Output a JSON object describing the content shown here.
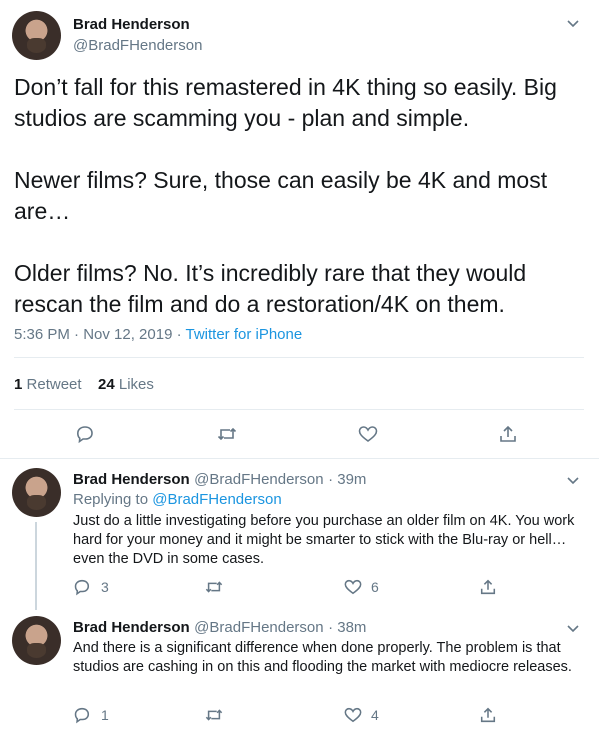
{
  "colors": {
    "accent": "#1b95e0",
    "muted": "#657786",
    "text": "#14171a",
    "divider": "#e6ecf0"
  },
  "main_tweet": {
    "author_name": "Brad Henderson",
    "author_handle": "@BradFHenderson",
    "text": "Don’t fall for this remastered in 4K thing so easily. Big studios are scamming you - plan and simple.\n\nNewer films? Sure, those can easily be 4K and most are…\n\nOlder films? No. It’s incredibly rare that they would rescan the film and do a restoration/4K on them.",
    "time": "5:36 PM · Nov 12, 2019 · ",
    "source": "Twitter for iPhone",
    "retweets_count": "1",
    "retweets_label": "Retweet",
    "likes_count": "24",
    "likes_label": "Likes"
  },
  "replies": [
    {
      "author_name": "Brad Henderson",
      "author_handle": "@BradFHenderson",
      "age": "· 39m",
      "replying_prefix": "Replying to ",
      "replying_to": "@BradFHenderson",
      "text": "Just do a little investigating before you purchase an older film on 4K. You work hard for your money and it might be smarter to stick with the Blu-ray or hell…even the DVD in some cases.",
      "reply_count": "3",
      "like_count": "6"
    },
    {
      "author_name": "Brad Henderson",
      "author_handle": "@BradFHenderson",
      "age": "· 38m",
      "text": "And there is a significant difference when done properly. The problem is that studios are cashing in on this and flooding the market with mediocre releases.",
      "reply_count": "1",
      "like_count": "4"
    }
  ]
}
